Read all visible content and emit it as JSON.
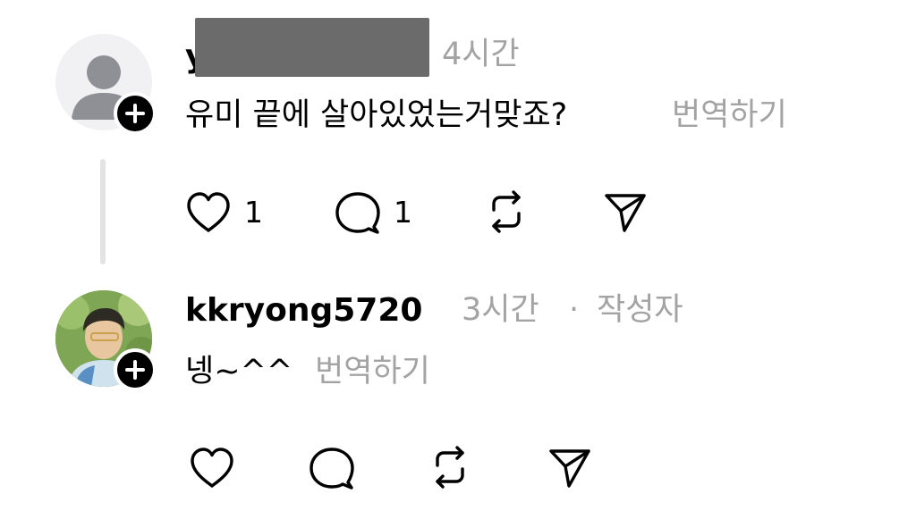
{
  "comments": [
    {
      "username": "y",
      "time": "4시간",
      "text": "유미 끝에 살아있었는거맞죠?",
      "translate": "번역하기",
      "likes": "1",
      "replies": "1"
    },
    {
      "username": "kkryong5720",
      "time": "3시간",
      "separator": "·",
      "author_tag": "작성자",
      "text": "넹~^^",
      "translate": "번역하기"
    }
  ],
  "icons": {
    "like": "heart-icon",
    "reply": "speech-bubble-icon",
    "repost": "repost-icon",
    "share": "send-icon",
    "follow": "plus-icon"
  }
}
